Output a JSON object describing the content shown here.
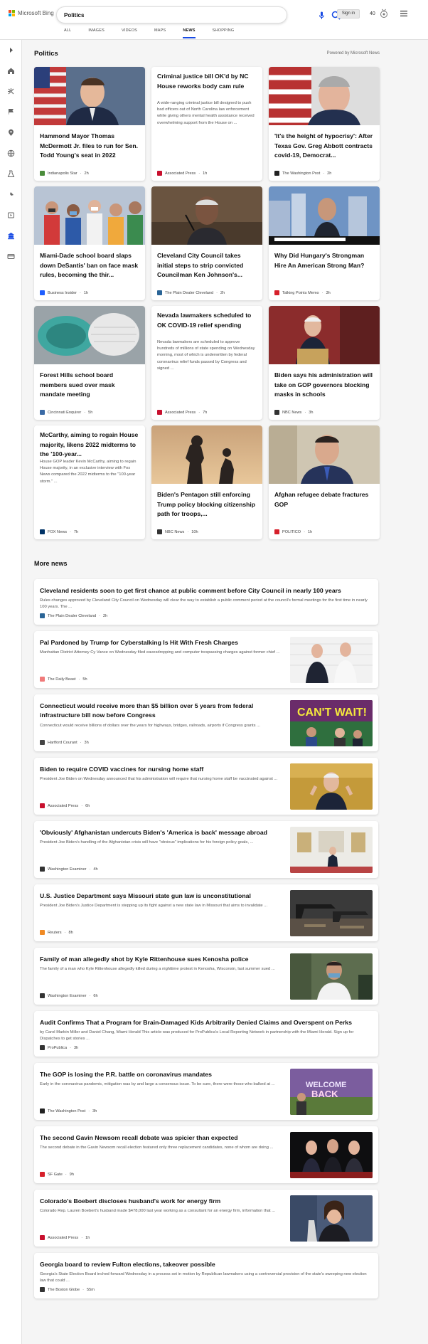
{
  "header": {
    "logo_text": "Microsoft Bing",
    "search_value": "Politics",
    "tabs": [
      "ALL",
      "IMAGES",
      "VIDEOS",
      "MAPS",
      "NEWS",
      "SHOPPING"
    ],
    "active_tab": "NEWS",
    "signin_label": "Sign in",
    "reward_points": "40"
  },
  "rail": {
    "icons": [
      "expand-icon",
      "home-icon",
      "sports-icon",
      "flag-icon",
      "location-icon",
      "world-icon",
      "science-icon",
      "technology-icon",
      "entertainment-icon",
      "politics-icon",
      "money-icon"
    ]
  },
  "section": {
    "title": "Politics",
    "powered_by": "Powered by Microsoft News",
    "more_news_title": "More news"
  },
  "cards": [
    {
      "title": "Hammond Mayor Thomas McDermott Jr. files to run for Sen. Todd Young's seat in 2022",
      "snippet": "",
      "source": "Indianapolis Star",
      "time": "2h",
      "image": "man-suit-flag",
      "source_color": "#4a8c3a"
    },
    {
      "title": "Criminal justice bill OK'd by NC House reworks body cam rule",
      "snippet": "A wide-ranging criminal justice bill designed to push bad officers out of North Carolina law enforcement while giving others mental health assistance received overwhelming support from the House on ...",
      "source": "Associated Press",
      "time": "1h",
      "image": "",
      "source_color": "#c8102e"
    },
    {
      "title": "'It's the height of hypocrisy': After Texas Gov. Greg Abbott contracts covid-19, Democrat...",
      "snippet": "",
      "source": "The Washington Post",
      "time": "2h",
      "image": "man-flag-closeup",
      "source_color": "#222"
    },
    {
      "title": "Miami-Dade school board slaps down DeSantis' ban on face mask rules, becoming the thir...",
      "snippet": "",
      "source": "Business Insider",
      "time": "1h",
      "image": "kids-masks",
      "source_color": "#1e5eff"
    },
    {
      "title": "Cleveland City Council takes initial steps to strip convicted Councilman Ken Johnson's...",
      "snippet": "",
      "source": "The Plain Dealer Cleveland",
      "time": "2h",
      "image": "council-man",
      "source_color": "#2a6496"
    },
    {
      "title": "Why Did Hungary's Strongman Hire An American Strong Man?",
      "snippet": "",
      "source": "Talking Points Memo",
      "time": "3h",
      "image": "tv-interview",
      "source_color": "#d6202b"
    },
    {
      "title": "Forest Hills school board members sued over mask mandate meeting",
      "snippet": "",
      "source": "Cincinnati Enquirer",
      "time": "5h",
      "image": "masks",
      "source_color": "#3a6aa5"
    },
    {
      "title": "Nevada lawmakers scheduled to OK COVID-19 relief spending",
      "snippet": "Nevada lawmakers are scheduled to approve hundreds of millions of state spending on Wednesday morning, most of which is underwritten by federal coronavirus relief funds passed by Congress and signed ...",
      "source": "Associated Press",
      "time": "7h",
      "image": "",
      "source_color": "#c8102e"
    },
    {
      "title": "Biden says his administration will take on GOP governors blocking masks in schools",
      "snippet": "",
      "source": "NBC News",
      "time": "3h",
      "image": "podium",
      "source_color": "#333"
    },
    {
      "title": "McCarthy, aiming to regain House majority, likens 2022 midterms to the '100-year...",
      "snippet": "House GOP leader Kevin McCarthy, aiming to regain House majority, in an exclusive interview with Fox News compared the 2022 midterms to the \"100-year storm.\" ...",
      "source": "FOX News",
      "time": "7h",
      "image": "",
      "source_color": "#003366"
    },
    {
      "title": "Biden's Pentagon still enforcing Trump policy blocking citizenship path for troops,...",
      "snippet": "",
      "source": "NBC News",
      "time": "10h",
      "image": "soldier-sunset",
      "source_color": "#333"
    },
    {
      "title": "Afghan refugee debate fractures GOP",
      "snippet": "",
      "source": "POLITICO",
      "time": "1h",
      "image": "man-suit-office",
      "source_color": "#d6202b"
    }
  ],
  "more_news": [
    {
      "title": "Cleveland residents soon to get first chance at public comment before City Council in nearly 100 years",
      "snippet": "Rules changes approved by Cleveland City Council on Wednesday will clear the way to establish a public comment period at the council's formal meetings for the first time in nearly 100 years. The ...",
      "source": "The Plain Dealer Cleveland",
      "time": "2h",
      "image": "",
      "source_color": "#2a6496"
    },
    {
      "title": "Pal Pardoned by Trump for Cyberstalking Is Hit With Fresh Charges",
      "snippet": "Manhattan District Attorney Cy Vance on Wednesday filed eavesdropping and computer trespassing charges against former chief ...",
      "source": "The Daily Beast",
      "time": "5h",
      "image": "two-men",
      "source_color": "#f07a7a"
    },
    {
      "title": "Connecticut would receive more than $5 billion over 5 years from federal infrastructure bill now before Congress",
      "snippet": "Connecticut would receive billions of dollars over the years for highways, bridges, railroads, airports if Congress grants ...",
      "source": "Hartford Courant",
      "time": "3h",
      "image": "cant-wait",
      "source_color": "#444"
    },
    {
      "title": "Biden to require COVID vaccines for nursing home staff",
      "snippet": "President Joe Biden on Wednesday announced that his administration will require that nursing home staff be vaccinated against ...",
      "source": "Associated Press",
      "time": "6h",
      "image": "biden-gold",
      "source_color": "#c8102e"
    },
    {
      "title": "'Obviously' Afghanistan undercuts Biden's 'America is back' message abroad",
      "snippet": "President Joe Biden's handling of the Afghanistan crisis will have \"obvious\" implications for his foreign policy goals, ...",
      "source": "Washington Examiner",
      "time": "4h",
      "image": "white-house",
      "source_color": "#333"
    },
    {
      "title": "U.S. Justice Department says Missouri state gun law is unconstitutional",
      "snippet": "President Joe Biden's Justice Department is stepping up its fight against a new state law in Missouri that aims to invalidate ...",
      "source": "Reuters",
      "time": "8h",
      "image": "guns",
      "source_color": "#f08a24"
    },
    {
      "title": "Family of man allegedly shot by Kyle Rittenhouse sues Kenosha police",
      "snippet": "The family of a man who Kyle Rittenhouse allegedly killed during a nighttime protest in Kenosha, Wisconsin, last summer sued ...",
      "source": "Washington Examiner",
      "time": "6h",
      "image": "court",
      "source_color": "#333"
    },
    {
      "title": "Audit Confirms That a Program for Brain-Damaged Kids Arbitrarily Denied Claims and Overspent on Perks",
      "snippet": "by Carol Marbin Miller and Daniel Chang, Miami Herald This article was produced for ProPublica's Local Reporting Network in partnership with the Miami Herald. Sign up for Dispatches to get stories ...",
      "source": "ProPublica",
      "time": "3h",
      "image": "",
      "source_color": "#333"
    },
    {
      "title": "The GOP is losing the P.R. battle on coronavirus mandates",
      "snippet": "Early in the coronavirus pandemic, mitigation was by and large a consensus issue. To be sure, there were those who balked at ...",
      "source": "The Washington Post",
      "time": "3h",
      "image": "welcome-back",
      "source_color": "#222"
    },
    {
      "title": "The second Gavin Newsom recall debate was spicier than expected",
      "snippet": "The second debate in the Gavin Newsom recall election featured only three replacement candidates, none of whom are doing ...",
      "source": "SF Gate",
      "time": "9h",
      "image": "debate",
      "source_color": "#d6202b"
    },
    {
      "title": "Colorado's Boebert discloses husband's work for energy firm",
      "snippet": "Colorado Rep. Lauren Boebert's husband made $478,000 last year working as a consultant for an energy firm, information that ...",
      "source": "Associated Press",
      "time": "1h",
      "image": "boebert",
      "source_color": "#c8102e"
    },
    {
      "title": "Georgia board to review Fulton elections, takeover possible",
      "snippet": "Georgia's State Election Board inched forward Wednesday in a process set in motion by Republican lawmakers using a controversial provision of the state's sweeping new election law that could ...",
      "source": "The Boston Globe",
      "time": "55m",
      "image": "",
      "source_color": "#333"
    }
  ]
}
